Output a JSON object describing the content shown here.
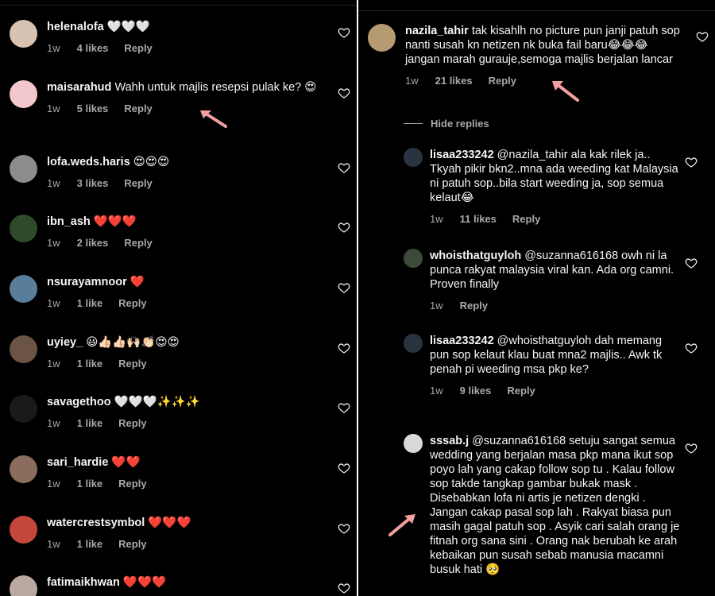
{
  "left": {
    "comments": [
      {
        "user": "helenalofa",
        "text": "🤍🤍🤍",
        "time": "1w",
        "likes": "4 likes",
        "reply": "Reply",
        "avatar_color": "#d8c3b3"
      },
      {
        "user": "maisarahud",
        "text": "Wahh untuk majlis resepsi pulak ke? 😍",
        "time": "1w",
        "likes": "5 likes",
        "reply": "Reply",
        "avatar_color": "#f2c8cc"
      },
      {
        "user": "lofa.weds.haris",
        "text": "😍😍😍",
        "time": "1w",
        "likes": "3 likes",
        "reply": "Reply",
        "avatar_color": "#8c8c8c"
      },
      {
        "user": "ibn_ash",
        "text": "❤️❤️❤️",
        "time": "1w",
        "likes": "2 likes",
        "reply": "Reply",
        "avatar_color": "#2f4a2a"
      },
      {
        "user": "nsurayamnoor",
        "text": "❤️",
        "time": "1w",
        "likes": "1 like",
        "reply": "Reply",
        "avatar_color": "#5a7d9a"
      },
      {
        "user": "uyiey_",
        "text": "😃👍🏻👍🏻🙌🏻👏🏻😍😍",
        "time": "1w",
        "likes": "1 like",
        "reply": "Reply",
        "avatar_color": "#6b5346"
      },
      {
        "user": "savagethoo",
        "text": "🤍🤍🤍✨✨✨",
        "time": "1w",
        "likes": "1 like",
        "reply": "Reply",
        "avatar_color": "#1a1a1a"
      },
      {
        "user": "sari_hardie",
        "text": "❤️❤️",
        "time": "1w",
        "likes": "1 like",
        "reply": "Reply",
        "avatar_color": "#8a6d5c"
      },
      {
        "user": "watercrestsymbol",
        "text": "❤️❤️❤️",
        "time": "1w",
        "likes": "1 like",
        "reply": "Reply",
        "avatar_color": "#c3473c"
      },
      {
        "user": "fatimaikhwan",
        "text": "❤️❤️❤️",
        "time": "",
        "likes": "",
        "reply": "",
        "avatar_color": "#b9a9a0"
      }
    ]
  },
  "right": {
    "main": {
      "user": "nazila_tahir",
      "text": "tak kisahlh no picture pun janji patuh sop nanti susah kn netizen nk buka fail baru😂😂😂 jangan marah gurauje,semoga majlis berjalan lancar",
      "time": "1w",
      "likes": "21 likes",
      "reply": "Reply",
      "avatar_color": "#b59a73"
    },
    "hide_replies": "Hide replies",
    "replies": [
      {
        "user": "lisaa233242",
        "text": "@nazila_tahir ala kak rilek ja.. Tkyah pikir bkn2..mna ada weeding kat Malaysia ni patuh sop..bila start weeding ja, sop semua kelaut😂",
        "time": "1w",
        "likes": "11 likes",
        "reply": "Reply",
        "avatar_color": "#2a3340"
      },
      {
        "user": "whoisthatguyloh",
        "text": "@suzanna616168 owh ni la punca rakyat malaysia viral kan. Ada org camni. Proven finally",
        "time": "1w",
        "likes": "",
        "reply": "Reply",
        "avatar_color": "#3d4a3a"
      },
      {
        "user": "lisaa233242",
        "text": "@whoisthatguyloh dah memang pun sop kelaut klau buat mna2 majlis.. Awk tk penah pi weeding msa pkp ke?",
        "time": "1w",
        "likes": "9 likes",
        "reply": "Reply",
        "avatar_color": "#2a3340"
      },
      {
        "user": "sssab.j",
        "text": "@suzanna616168 setuju sangat semua wedding yang berjalan masa pkp mana ikut sop poyo lah yang cakap follow sop tu . Kalau follow sop takde tangkap gambar bukak mask . Disebabkan lofa ni artis je netizen dengki . Jangan cakap pasal sop lah . Rakyat biasa pun masih gagal patuh sop . Asyik cari salah orang je fitnah org sana sini . Orang nak berubah ke arah kebaikan pun susah sebab manusia macamni busuk hati 🥺",
        "time": "",
        "likes": "",
        "reply": "",
        "avatar_color": "#d9d9d9"
      }
    ]
  },
  "colors": {
    "arrow": "#f4a0a0",
    "muted": "#a8a8a8"
  }
}
